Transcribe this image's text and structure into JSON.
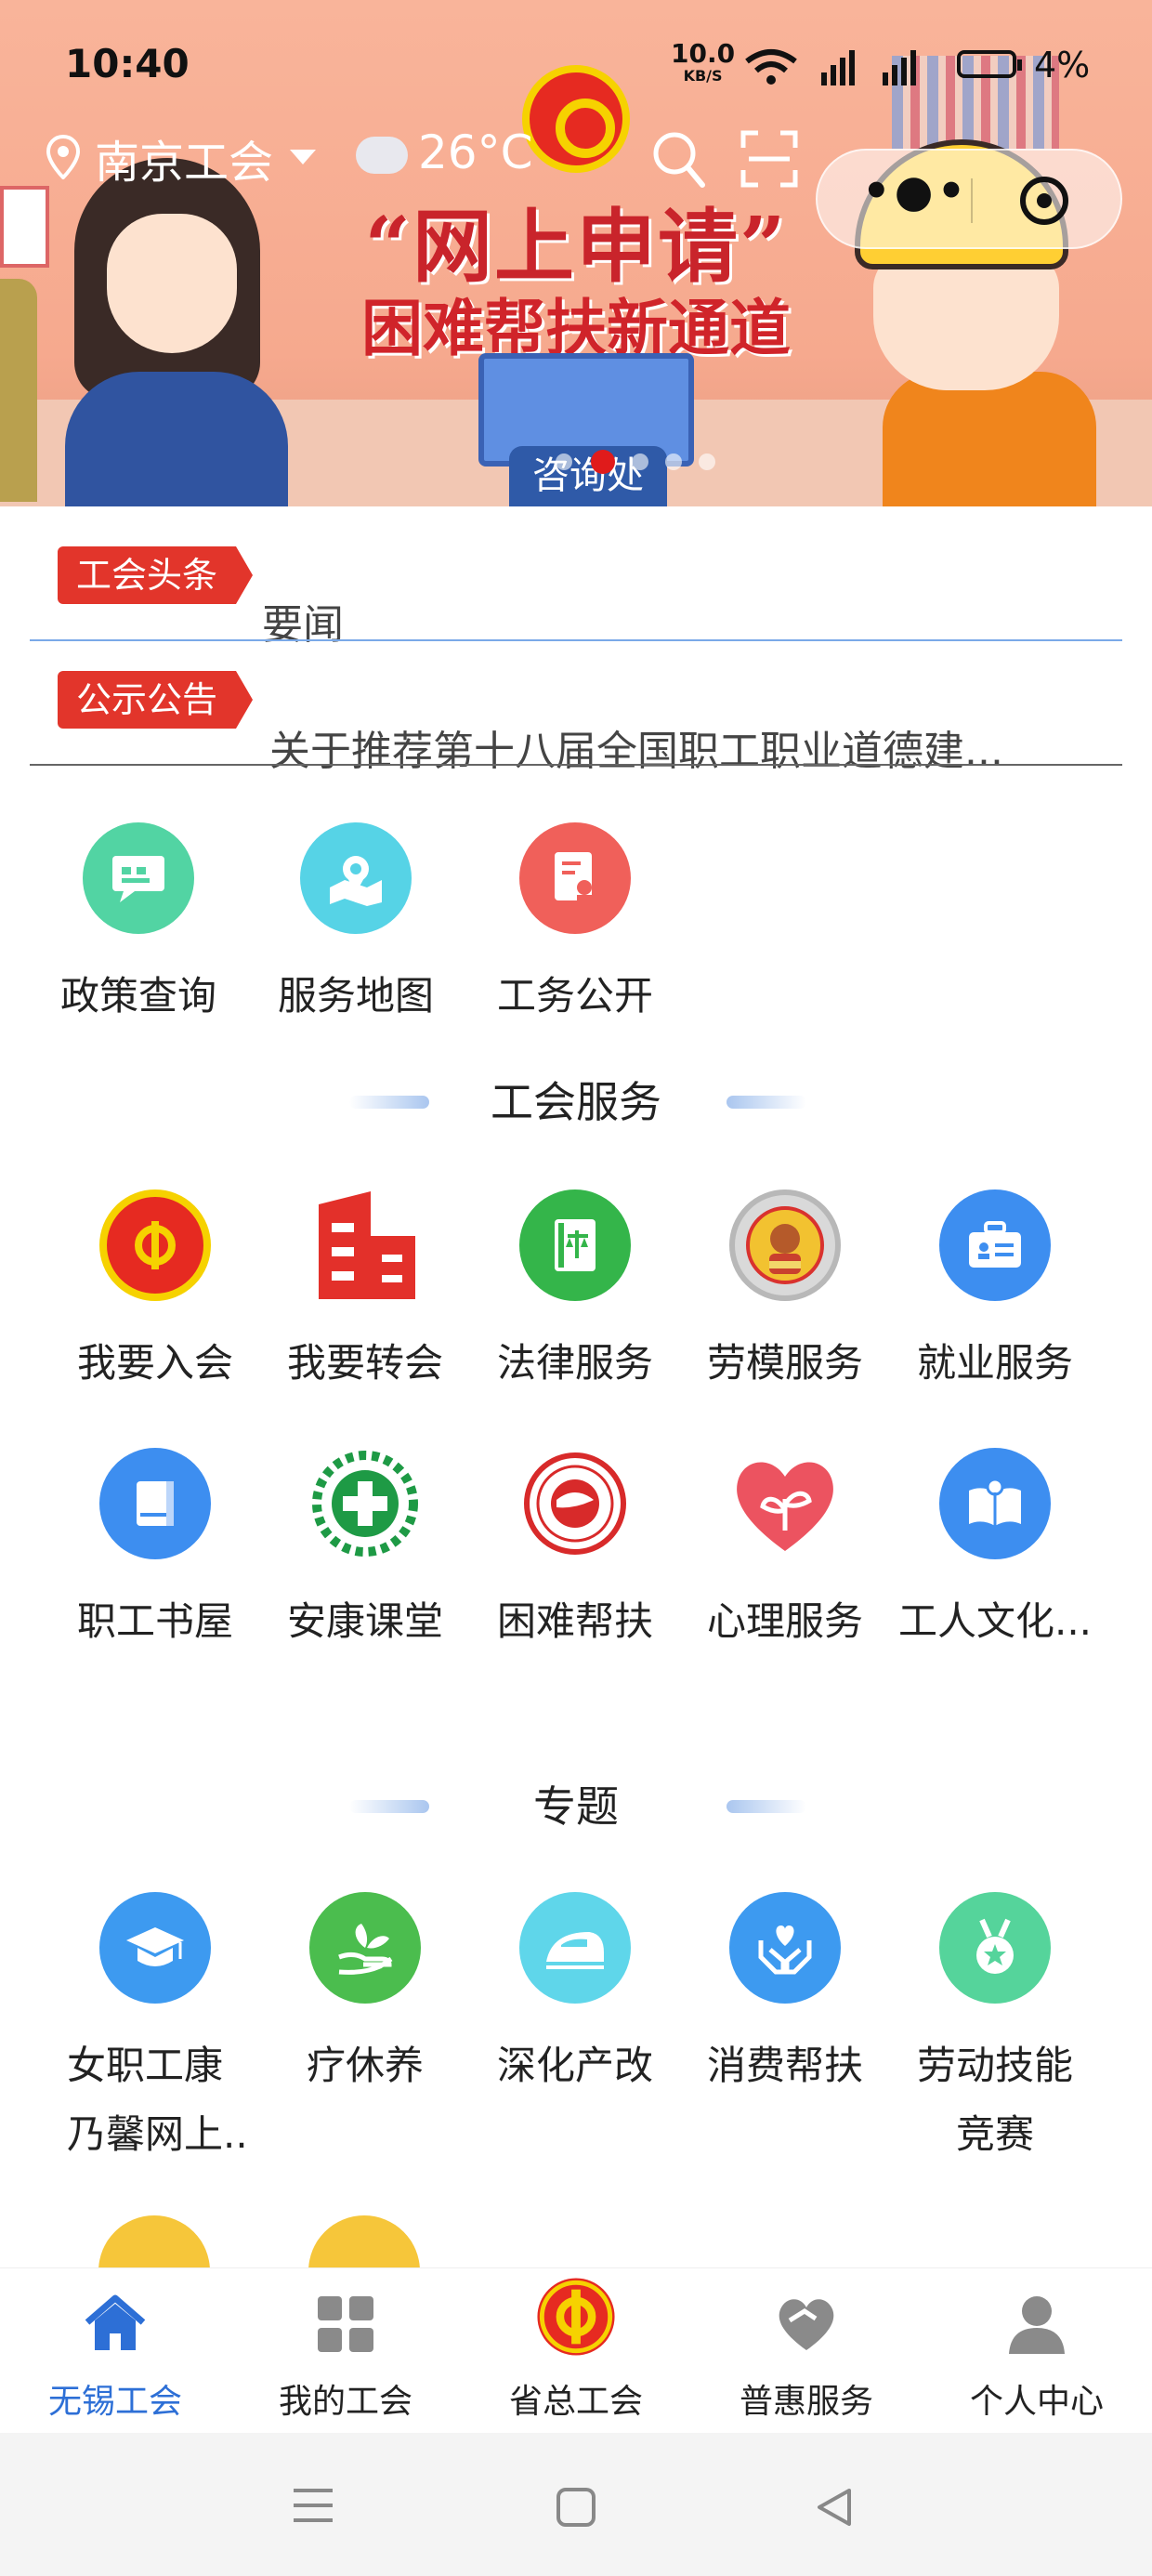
{
  "status_bar": {
    "time": "10:40",
    "net_speed": "10.0",
    "net_unit": "KB/S",
    "battery": "4%"
  },
  "header": {
    "city": "南京工会",
    "temperature": "26°C"
  },
  "banner": {
    "title": "“网上申请”",
    "subtitle": "困难帮扶新通道",
    "desk_sign": "咨询处"
  },
  "news": [
    {
      "tag": "工会头条",
      "text": "要闻"
    },
    {
      "tag": "公示公告",
      "text": "关于推荐第十八届全国职工职业道德建..."
    }
  ],
  "quick_links": [
    {
      "label": "政策查询",
      "icon": "chat-icon",
      "color": "#52d4a3"
    },
    {
      "label": "服务地图",
      "icon": "map-icon",
      "color": "#56d3e6"
    },
    {
      "label": "工务公开",
      "icon": "document-icon",
      "color": "#f0605a"
    }
  ],
  "union_services": {
    "title": "工会服务",
    "items": [
      {
        "label": "我要入会",
        "icon": "union-emblem-icon",
        "color": "#e62a21"
      },
      {
        "label": "我要转会",
        "icon": "building-icon",
        "color": "#e3302a"
      },
      {
        "label": "法律服务",
        "icon": "law-book-icon",
        "color": "#34b54a"
      },
      {
        "label": "劳模服务",
        "icon": "model-worker-badge-icon",
        "color": "#c9a33a"
      },
      {
        "label": "就业服务",
        "icon": "briefcase-icon",
        "color": "#3d8ef0"
      },
      {
        "label": "职工书屋",
        "icon": "book-icon",
        "color": "#3d8ef0"
      },
      {
        "label": "安康课堂",
        "icon": "health-cross-icon",
        "color": "#1e9a45"
      },
      {
        "label": "困难帮扶",
        "icon": "aid-seal-icon",
        "color": "#d82a2a"
      },
      {
        "label": "心理服务",
        "icon": "heart-leaf-icon",
        "color": "#ec5360"
      },
      {
        "label": "工人文化...",
        "icon": "open-book-icon",
        "color": "#3d8ef0"
      }
    ]
  },
  "topics": {
    "title": "专题",
    "items": [
      {
        "label": "女职工康",
        "label2": "乃馨网上..",
        "icon": "graduation-cap-icon",
        "color": "#3d9af0"
      },
      {
        "label": "疗休养",
        "label2": "",
        "icon": "hand-leaf-icon",
        "color": "#4bbd4e"
      },
      {
        "label": "深化产改",
        "label2": "",
        "icon": "train-icon",
        "color": "#5fd6ea"
      },
      {
        "label": "消费帮扶",
        "label2": "",
        "icon": "hands-heart-icon",
        "color": "#3d9af0"
      },
      {
        "label": "劳动技能",
        "label2": "竞赛",
        "icon": "medal-icon",
        "color": "#55d49b"
      }
    ]
  },
  "tab_bar": [
    {
      "label": "无锡工会",
      "icon": "home-icon",
      "active": true
    },
    {
      "label": "我的工会",
      "icon": "grid-icon",
      "active": false
    },
    {
      "label": "省总工会",
      "icon": "union-emblem-icon",
      "active": false
    },
    {
      "label": "普惠服务",
      "icon": "heart-icon",
      "active": false
    },
    {
      "label": "个人中心",
      "icon": "person-icon",
      "active": false
    }
  ],
  "colors": {
    "accent": "#2d6fd6",
    "tag_red": "#e2352b",
    "banner_bg": "#f7ad92"
  }
}
